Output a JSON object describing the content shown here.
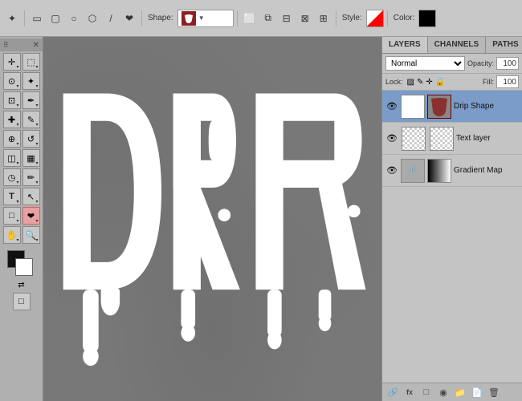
{
  "toolbar": {
    "shape_label": "Shape:",
    "style_label": "Style:",
    "color_label": "Color:"
  },
  "tools_panel": {
    "title": "▶",
    "close": "✕"
  },
  "right_panel": {
    "tabs": [
      "LAYERS",
      "CHANNELS",
      "PATHS"
    ],
    "active_tab": "LAYERS",
    "blend_mode": "Normal",
    "opacity_label": "Opacity:",
    "opacity_value": "100",
    "lock_label": "Lock:",
    "fill_label": "Fill:",
    "fill_value": "100",
    "layers": [
      {
        "name": "Drip Shape",
        "visible": true,
        "active": true,
        "type": "shape"
      },
      {
        "name": "Text layer",
        "visible": true,
        "active": false,
        "type": "text"
      },
      {
        "name": "Gradient Map",
        "visible": true,
        "active": false,
        "type": "adjustment"
      }
    ],
    "bottom_icons": [
      "🔗",
      "fx",
      "□",
      "◎",
      "🗑"
    ]
  }
}
